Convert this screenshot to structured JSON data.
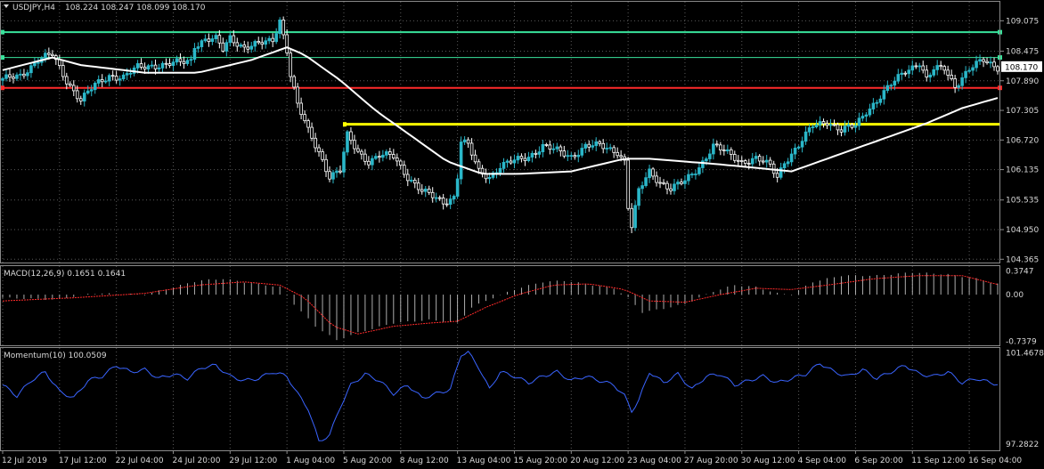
{
  "chart_data": {
    "type": "candlestick",
    "symbol_header": "USDJPY,H4",
    "ohlc_readout": "108.224 108.247 108.099 108.170",
    "price_axis": {
      "ticks": [
        "109.075",
        "108.475",
        "107.890",
        "107.305",
        "106.720",
        "106.135",
        "105.535",
        "104.950",
        "104.365"
      ],
      "tick_values": [
        109.075,
        108.475,
        107.89,
        107.305,
        106.72,
        106.135,
        105.535,
        104.95,
        104.365
      ],
      "ylim": [
        104.3,
        109.45
      ],
      "current_price_label": "108.170",
      "current_price": 108.17
    },
    "time_axis": {
      "labels": [
        "12 Jul 2019",
        "17 Jul 12:00",
        "22 Jul 04:00",
        "24 Jul 20:00",
        "29 Jul 12:00",
        "1 Aug 04:00",
        "5 Aug 20:00",
        "8 Aug 12:00",
        "13 Aug 04:00",
        "15 Aug 20:00",
        "20 Aug 12:00",
        "23 Aug 04:00",
        "27 Aug 20:00",
        "30 Aug 12:00",
        "4 Sep 04:00",
        "6 Sep 20:00",
        "11 Sep 12:00",
        "16 Sep 04:00"
      ],
      "label_bars": [
        0,
        16,
        32,
        48,
        64,
        80,
        96,
        112,
        128,
        144,
        160,
        176,
        192,
        208,
        224,
        240,
        256,
        272
      ]
    },
    "bar_count": 281,
    "close_path": [
      [
        0,
        107.9
      ],
      [
        5,
        108.0
      ],
      [
        10,
        108.3
      ],
      [
        14,
        108.4
      ],
      [
        18,
        107.9
      ],
      [
        22,
        107.5
      ],
      [
        26,
        107.8
      ],
      [
        30,
        108.0
      ],
      [
        34,
        107.95
      ],
      [
        38,
        108.15
      ],
      [
        42,
        108.2
      ],
      [
        46,
        108.2
      ],
      [
        50,
        108.25
      ],
      [
        53,
        108.3
      ],
      [
        54,
        108.6
      ],
      [
        57,
        108.7
      ],
      [
        60,
        108.7
      ],
      [
        62,
        108.5
      ],
      [
        64,
        108.75
      ],
      [
        68,
        108.55
      ],
      [
        72,
        108.6
      ],
      [
        76,
        108.7
      ],
      [
        78,
        109.1
      ],
      [
        80,
        108.5
      ],
      [
        81,
        108.0
      ],
      [
        83,
        107.4
      ],
      [
        86,
        106.9
      ],
      [
        89,
        106.5
      ],
      [
        92,
        106.0
      ],
      [
        95,
        106.1
      ],
      [
        97,
        106.8
      ],
      [
        100,
        106.5
      ],
      [
        103,
        106.3
      ],
      [
        106,
        106.4
      ],
      [
        110,
        106.4
      ],
      [
        114,
        106.0
      ],
      [
        118,
        105.7
      ],
      [
        121,
        105.6
      ],
      [
        124,
        105.5
      ],
      [
        127,
        105.6
      ],
      [
        128,
        106.0
      ],
      [
        129,
        106.7
      ],
      [
        131,
        106.6
      ],
      [
        134,
        106.1
      ],
      [
        137,
        106.0
      ],
      [
        140,
        106.2
      ],
      [
        144,
        106.3
      ],
      [
        148,
        106.4
      ],
      [
        152,
        106.6
      ],
      [
        156,
        106.5
      ],
      [
        160,
        106.4
      ],
      [
        164,
        106.6
      ],
      [
        168,
        106.6
      ],
      [
        173,
        106.5
      ],
      [
        175,
        106.3
      ],
      [
        176,
        105.4
      ],
      [
        177,
        105.0
      ],
      [
        179,
        105.7
      ],
      [
        182,
        106.1
      ],
      [
        185,
        105.9
      ],
      [
        188,
        105.75
      ],
      [
        192,
        105.9
      ],
      [
        196,
        106.2
      ],
      [
        200,
        106.6
      ],
      [
        204,
        106.45
      ],
      [
        208,
        106.3
      ],
      [
        212,
        106.35
      ],
      [
        216,
        106.2
      ],
      [
        218,
        106.0
      ],
      [
        220,
        106.3
      ],
      [
        224,
        106.6
      ],
      [
        228,
        107.0
      ],
      [
        232,
        107.1
      ],
      [
        236,
        106.9
      ],
      [
        240,
        107.0
      ],
      [
        243,
        107.3
      ],
      [
        246,
        107.5
      ],
      [
        250,
        107.8
      ],
      [
        254,
        108.1
      ],
      [
        258,
        108.25
      ],
      [
        260,
        107.9
      ],
      [
        262,
        108.1
      ],
      [
        265,
        108.15
      ],
      [
        268,
        107.8
      ],
      [
        272,
        108.1
      ],
      [
        276,
        108.3
      ],
      [
        280,
        108.17
      ]
    ],
    "moving_average_path": [
      [
        0,
        108.1
      ],
      [
        14,
        108.35
      ],
      [
        22,
        108.2
      ],
      [
        40,
        108.05
      ],
      [
        55,
        108.05
      ],
      [
        70,
        108.3
      ],
      [
        80,
        108.55
      ],
      [
        85,
        108.4
      ],
      [
        95,
        107.9
      ],
      [
        105,
        107.3
      ],
      [
        115,
        106.8
      ],
      [
        125,
        106.3
      ],
      [
        135,
        106.05
      ],
      [
        145,
        106.05
      ],
      [
        160,
        106.1
      ],
      [
        175,
        106.35
      ],
      [
        182,
        106.35
      ],
      [
        200,
        106.25
      ],
      [
        215,
        106.15
      ],
      [
        222,
        106.1
      ],
      [
        230,
        106.3
      ],
      [
        240,
        106.55
      ],
      [
        250,
        106.8
      ],
      [
        260,
        107.05
      ],
      [
        270,
        107.35
      ],
      [
        280,
        107.55
      ]
    ],
    "horizontal_levels": [
      {
        "price": 108.85,
        "color": "#39e29b",
        "from_bar": 0,
        "to_bar": 280,
        "thickness": 2
      },
      {
        "price": 108.35,
        "color": "#39e29b",
        "from_bar": 0,
        "to_bar": 280,
        "thickness": 1
      },
      {
        "price": 107.75,
        "color": "#ff2a2a",
        "from_bar": 0,
        "to_bar": 280,
        "thickness": 2
      },
      {
        "price": 107.03,
        "color": "#ffff00",
        "from_bar": 96,
        "to_bar": 280,
        "thickness": 3
      }
    ],
    "macd": {
      "header": "MACD(12,26,9) 0.1651 0.1641",
      "ticks": [
        "0.3747",
        "0.00",
        "-0.7379"
      ],
      "tick_values": [
        0.3747,
        0.0,
        -0.7379
      ],
      "ylim": [
        -0.8,
        0.45
      ],
      "histogram_path": [
        [
          0,
          -0.05
        ],
        [
          15,
          -0.08
        ],
        [
          25,
          0.02
        ],
        [
          40,
          0.0
        ],
        [
          55,
          0.22
        ],
        [
          62,
          0.25
        ],
        [
          70,
          0.18
        ],
        [
          78,
          0.12
        ],
        [
          82,
          -0.15
        ],
        [
          88,
          -0.5
        ],
        [
          94,
          -0.72
        ],
        [
          100,
          -0.6
        ],
        [
          110,
          -0.45
        ],
        [
          120,
          -0.4
        ],
        [
          128,
          -0.45
        ],
        [
          132,
          -0.2
        ],
        [
          138,
          -0.05
        ],
        [
          145,
          0.1
        ],
        [
          152,
          0.2
        ],
        [
          158,
          0.22
        ],
        [
          166,
          0.15
        ],
        [
          172,
          0.1
        ],
        [
          176,
          -0.05
        ],
        [
          180,
          -0.28
        ],
        [
          186,
          -0.22
        ],
        [
          192,
          -0.15
        ],
        [
          200,
          0.05
        ],
        [
          206,
          0.15
        ],
        [
          212,
          0.12
        ],
        [
          218,
          0.02
        ],
        [
          222,
          0.0
        ],
        [
          228,
          0.2
        ],
        [
          236,
          0.3
        ],
        [
          246,
          0.3
        ],
        [
          256,
          0.35
        ],
        [
          266,
          0.32
        ],
        [
          274,
          0.25
        ],
        [
          280,
          0.17
        ]
      ],
      "signal_path": [
        [
          0,
          -0.1
        ],
        [
          20,
          -0.05
        ],
        [
          40,
          0.02
        ],
        [
          55,
          0.15
        ],
        [
          68,
          0.2
        ],
        [
          78,
          0.15
        ],
        [
          85,
          -0.05
        ],
        [
          93,
          -0.5
        ],
        [
          100,
          -0.62
        ],
        [
          110,
          -0.5
        ],
        [
          120,
          -0.45
        ],
        [
          128,
          -0.42
        ],
        [
          136,
          -0.2
        ],
        [
          145,
          0.0
        ],
        [
          155,
          0.15
        ],
        [
          165,
          0.17
        ],
        [
          175,
          0.08
        ],
        [
          182,
          -0.1
        ],
        [
          192,
          -0.12
        ],
        [
          202,
          0.0
        ],
        [
          212,
          0.1
        ],
        [
          222,
          0.08
        ],
        [
          232,
          0.15
        ],
        [
          245,
          0.25
        ],
        [
          258,
          0.3
        ],
        [
          270,
          0.3
        ],
        [
          280,
          0.16
        ]
      ]
    },
    "momentum": {
      "header": "Momentum(10) 100.0509",
      "ticks": [
        "101.4678",
        "97.2822"
      ],
      "tick_values": [
        101.4678,
        97.2822
      ],
      "ylim": [
        97.0,
        101.7
      ],
      "path": [
        [
          0,
          100.0
        ],
        [
          4,
          99.5
        ],
        [
          8,
          100.2
        ],
        [
          12,
          100.6
        ],
        [
          16,
          99.7
        ],
        [
          20,
          99.4
        ],
        [
          24,
          100.2
        ],
        [
          28,
          100.4
        ],
        [
          32,
          100.9
        ],
        [
          36,
          100.6
        ],
        [
          40,
          100.7
        ],
        [
          44,
          100.3
        ],
        [
          48,
          100.5
        ],
        [
          52,
          100.3
        ],
        [
          56,
          100.8
        ],
        [
          60,
          100.9
        ],
        [
          64,
          100.4
        ],
        [
          68,
          100.2
        ],
        [
          72,
          100.3
        ],
        [
          76,
          100.6
        ],
        [
          80,
          100.4
        ],
        [
          83,
          99.6
        ],
        [
          86,
          98.9
        ],
        [
          89,
          97.4
        ],
        [
          92,
          97.7
        ],
        [
          95,
          99.0
        ],
        [
          98,
          100.0
        ],
        [
          102,
          100.5
        ],
        [
          106,
          100.2
        ],
        [
          110,
          99.6
        ],
        [
          114,
          100.0
        ],
        [
          118,
          99.4
        ],
        [
          122,
          99.6
        ],
        [
          126,
          99.8
        ],
        [
          129,
          101.4
        ],
        [
          131,
          101.5
        ],
        [
          134,
          100.8
        ],
        [
          137,
          99.8
        ],
        [
          140,
          100.6
        ],
        [
          144,
          100.4
        ],
        [
          148,
          100.1
        ],
        [
          152,
          100.4
        ],
        [
          156,
          100.6
        ],
        [
          160,
          100.2
        ],
        [
          164,
          100.4
        ],
        [
          168,
          100.2
        ],
        [
          172,
          100.0
        ],
        [
          175,
          99.5
        ],
        [
          177,
          98.8
        ],
        [
          179,
          99.3
        ],
        [
          182,
          100.6
        ],
        [
          186,
          100.1
        ],
        [
          190,
          100.5
        ],
        [
          194,
          99.8
        ],
        [
          198,
          100.4
        ],
        [
          202,
          100.5
        ],
        [
          206,
          100.0
        ],
        [
          210,
          100.2
        ],
        [
          214,
          100.4
        ],
        [
          218,
          100.1
        ],
        [
          222,
          100.3
        ],
        [
          226,
          100.5
        ],
        [
          230,
          101.0
        ],
        [
          234,
          100.6
        ],
        [
          238,
          100.4
        ],
        [
          242,
          100.7
        ],
        [
          246,
          100.3
        ],
        [
          250,
          100.6
        ],
        [
          254,
          100.9
        ],
        [
          258,
          100.5
        ],
        [
          262,
          100.4
        ],
        [
          266,
          100.6
        ],
        [
          270,
          100.1
        ],
        [
          274,
          100.3
        ],
        [
          278,
          100.1
        ],
        [
          280,
          100.05
        ]
      ]
    },
    "colors": {
      "up": "#2ab7c9",
      "down": "#ffffff",
      "ma": "#ffffff",
      "grid": "#5a5a5a",
      "macd_hist": "#c0c0c0",
      "macd_signal": "#ff2a2a",
      "momentum": "#3a64ff",
      "price_label_bg": "#ffffff"
    }
  }
}
